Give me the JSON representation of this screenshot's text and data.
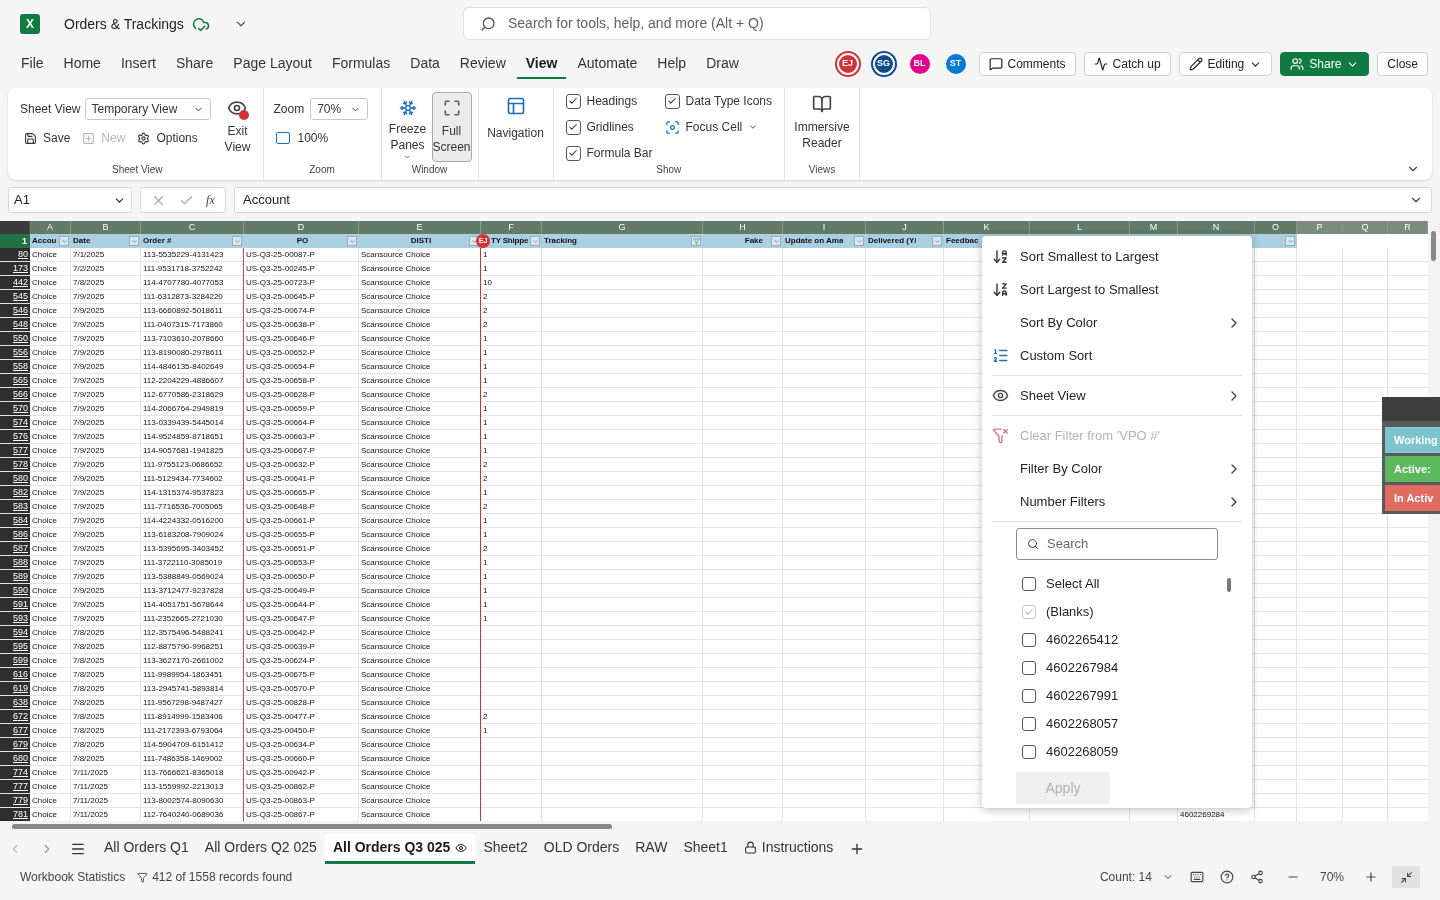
{
  "app": {
    "logo_text": "X",
    "title": "Orders & Trackings",
    "search_placeholder": "Search for tools, help, and more (Alt + Q)"
  },
  "menu_tabs": [
    {
      "label": "File",
      "selected": false
    },
    {
      "label": "Home",
      "selected": false
    },
    {
      "label": "Insert",
      "selected": false
    },
    {
      "label": "Share",
      "selected": false
    },
    {
      "label": "Page Layout",
      "selected": false
    },
    {
      "label": "Formulas",
      "selected": false
    },
    {
      "label": "Data",
      "selected": false
    },
    {
      "label": "Review",
      "selected": false
    },
    {
      "label": "View",
      "selected": true
    },
    {
      "label": "Automate",
      "selected": false
    },
    {
      "label": "Help",
      "selected": false
    },
    {
      "label": "Draw",
      "selected": false
    }
  ],
  "collaborators": [
    {
      "initials": "EJ",
      "color": "#d13438",
      "ring": true
    },
    {
      "initials": "SG",
      "color": "#0f4c8a",
      "ring": true
    },
    {
      "initials": "BL",
      "color": "#e3008c",
      "ring": false
    },
    {
      "initials": "ST",
      "color": "#0078d4",
      "ring": false
    }
  ],
  "header_buttons": [
    {
      "kind": "comments",
      "label": "Comments"
    },
    {
      "kind": "catch_up",
      "label": "Catch up"
    },
    {
      "kind": "editing",
      "label": "Editing"
    },
    {
      "kind": "share",
      "label": "Share"
    },
    {
      "kind": "close",
      "label": "Close"
    }
  ],
  "ribbon": {
    "sheet_view": {
      "label": "Sheet View",
      "view_label": "Sheet View",
      "view_value": "Temporary View",
      "exit": "Exit View",
      "actions": [
        {
          "kind": "save",
          "label": "Save",
          "disabled": false
        },
        {
          "kind": "new",
          "label": "New",
          "disabled": true
        },
        {
          "kind": "options",
          "label": "Options",
          "disabled": false
        }
      ]
    },
    "zoom": {
      "label": "Zoom",
      "zoom_label": "Zoom",
      "zoom_value": "70%",
      "reset": "100%"
    },
    "window": {
      "label": "Window",
      "buttons": [
        {
          "kind": "freeze",
          "label": "Freeze Panes",
          "dropdown": true,
          "selected": false
        },
        {
          "kind": "full_screen",
          "label": "Full Screen",
          "dropdown": false,
          "selected": true
        }
      ]
    },
    "navigation": {
      "label": "Navigation"
    },
    "show": {
      "label": "Show",
      "options": [
        {
          "kind": "checkbox",
          "label": "Headings",
          "checked": true
        },
        {
          "kind": "checkbox",
          "label": "Gridlines",
          "checked": true
        },
        {
          "kind": "checkbox",
          "label": "Formula Bar",
          "checked": true
        },
        {
          "kind": "checkbox",
          "label": "Data Type Icons",
          "checked": true
        },
        {
          "kind": "focus",
          "label": "Focus Cell"
        }
      ]
    },
    "views": {
      "label": "Views",
      "button": "Immersive Reader"
    }
  },
  "formula_bar": {
    "name_box": "A1",
    "function_label": "fx",
    "value": "Account"
  },
  "sheet": {
    "columns": [
      "A",
      "B",
      "C",
      "D",
      "E",
      "F",
      "G",
      "H",
      "I",
      "J",
      "K",
      "L",
      "M",
      "N",
      "O",
      "P",
      "Q",
      "R"
    ],
    "header_row": "1",
    "headers": [
      {
        "label": "Accou",
        "filtered": false
      },
      {
        "label": "Date",
        "filtered": false
      },
      {
        "label": "Order #",
        "filtered": false
      },
      {
        "label": "PO",
        "filtered": false
      },
      {
        "label": "DISTI",
        "filtered": false
      },
      {
        "label": "TY Shippe",
        "filtered": false
      },
      {
        "label": "Tracking",
        "filtered": true
      },
      {
        "label": "Fake",
        "filtered": false
      },
      {
        "label": "Update on Ama",
        "filtered": false
      },
      {
        "label": "Delivered (Y/",
        "filtered": false
      },
      {
        "label": "Feedbac"
      }
    ],
    "cursor": {
      "initials": "EJ",
      "color": "#d13438"
    },
    "rows": [
      {
        "number": "80",
        "cells": [
          "Choice",
          "7/1/2025",
          "113-5535229-4131423",
          "US-Q3-25-00087-P",
          "Scansource Choice"
        ],
        "qty": "1"
      },
      {
        "number": "173",
        "cells": [
          "Choice",
          "7/2/2025",
          "111-9531718-3752242",
          "US-Q3-25-00245-P",
          "Scansource Choice"
        ],
        "qty": "1"
      },
      {
        "number": "442",
        "cells": [
          "Choice",
          "7/8/2025",
          "114-4707780-4077053",
          "US-Q3-25-00723-P",
          "Scansource Choice"
        ],
        "qty": "10"
      },
      {
        "number": "545",
        "cells": [
          "Choice",
          "7/9/2025",
          "111-6312873-3284220",
          "US-Q3-25-00645-P",
          "Scansource Choice"
        ],
        "qty": "2"
      },
      {
        "number": "546",
        "cells": [
          "Choice",
          "7/9/2025",
          "113-6660892-5018611",
          "US-Q3-25-00674-P",
          "Scansource Choice"
        ],
        "qty": "2"
      },
      {
        "number": "548",
        "cells": [
          "Choice",
          "7/9/2025",
          "111-0407315-7173860",
          "US-Q3-25-00638-P",
          "Scansource Choice"
        ],
        "qty": "2"
      },
      {
        "number": "550",
        "cells": [
          "Choice",
          "7/9/2025",
          "113-7103610-2078660",
          "US-Q3-25-00646-P",
          "Scansource Choice"
        ],
        "qty": "1"
      },
      {
        "number": "556",
        "cells": [
          "Choice",
          "7/9/2025",
          "113-8190080-2978611",
          "US-Q3-25-00652-P",
          "Scansource Choice"
        ],
        "qty": "1"
      },
      {
        "number": "558",
        "cells": [
          "Choice",
          "7/9/2025",
          "114-4846135-8402649",
          "US-Q3-25-00654-P",
          "Scansource Choice"
        ],
        "qty": "1"
      },
      {
        "number": "565",
        "cells": [
          "Choice",
          "7/9/2025",
          "112-2204229-4886607",
          "US-Q3-25-00658-P",
          "Scansource Choice"
        ],
        "qty": "1"
      },
      {
        "number": "566",
        "cells": [
          "Choice",
          "7/9/2025",
          "112-6770586-2318629",
          "US-Q3-25-00628-P",
          "Scansource Choice"
        ],
        "qty": "2"
      },
      {
        "number": "570",
        "cells": [
          "Choice",
          "7/9/2025",
          "114-2066764-2949819",
          "US-Q3-25-00659-P",
          "Scansource Choice"
        ],
        "qty": "1"
      },
      {
        "number": "574",
        "cells": [
          "Choice",
          "7/9/2025",
          "113-0339439-5445014",
          "US-Q3-25-00664-P",
          "Scansource Choice"
        ],
        "qty": "1"
      },
      {
        "number": "576",
        "cells": [
          "Choice",
          "7/9/2025",
          "114-9524859-8718651",
          "US-Q3-25-00663-P",
          "Scansource Choice"
        ],
        "qty": "1"
      },
      {
        "number": "577",
        "cells": [
          "Choice",
          "7/9/2025",
          "114-9057681-1941825",
          "US-Q3-25-00667-P",
          "Scansource Choice"
        ],
        "qty": "1"
      },
      {
        "number": "578",
        "cells": [
          "Choice",
          "7/9/2025",
          "111-9755123-0686652",
          "US-Q3-25-00632-P",
          "Scansource Choice"
        ],
        "qty": "2"
      },
      {
        "number": "580",
        "cells": [
          "Choice",
          "7/9/2025",
          "111-5129434-7734602",
          "US-Q3-25-00641-P",
          "Scansource Choice"
        ],
        "qty": "2"
      },
      {
        "number": "582",
        "cells": [
          "Choice",
          "7/9/2025",
          "114-1315374-9537823",
          "US-Q3-25-00665-P",
          "Scansource Choice"
        ],
        "qty": "1"
      },
      {
        "number": "583",
        "cells": [
          "Choice",
          "7/9/2025",
          "111-7716536-7005065",
          "US-Q3-25-00648-P",
          "Scansource Choice"
        ],
        "qty": "2"
      },
      {
        "number": "584",
        "cells": [
          "Choice",
          "7/9/2025",
          "114-4224332-0516200",
          "US-Q3-25-00661-P",
          "Scansource Choice"
        ],
        "qty": "1"
      },
      {
        "number": "586",
        "cells": [
          "Choice",
          "7/9/2025",
          "113-6183208-7909024",
          "US-Q3-25-00655-P",
          "Scansource Choice"
        ],
        "qty": "1"
      },
      {
        "number": "587",
        "cells": [
          "Choice",
          "7/9/2025",
          "113-5395695-3403452",
          "US-Q3-25-00651-P",
          "Scansource Choice"
        ],
        "qty": "2"
      },
      {
        "number": "588",
        "cells": [
          "Choice",
          "7/9/2025",
          "111-3722110-3085019",
          "US-Q3-25-00653-P",
          "Scansource Choice"
        ],
        "qty": "1"
      },
      {
        "number": "589",
        "cells": [
          "Choice",
          "7/9/2025",
          "113-5388849-0569024",
          "US-Q3-25-00650-P",
          "Scansource Choice"
        ],
        "qty": "1"
      },
      {
        "number": "590",
        "cells": [
          "Choice",
          "7/9/2025",
          "113-3712477-9237828",
          "US-Q3-25-00649-P",
          "Scansource Choice"
        ],
        "qty": "1"
      },
      {
        "number": "591",
        "cells": [
          "Choice",
          "7/9/2025",
          "114-4051751-5678644",
          "US-Q3-25-00644-P",
          "Scansource Choice"
        ],
        "qty": "1"
      },
      {
        "number": "593",
        "cells": [
          "Choice",
          "7/9/2025",
          "111-2352665-2721030",
          "US-Q3-25-00647-P",
          "Scansource Choice"
        ],
        "qty": "1"
      },
      {
        "number": "594",
        "cells": [
          "Choice",
          "7/8/2025",
          "112-3575496-5488241",
          "US-Q3-25-00642-P",
          "Scansource Choice"
        ]
      },
      {
        "number": "595",
        "cells": [
          "Choice",
          "7/8/2025",
          "112-8875790-9968251",
          "US-Q3-25-00639-P",
          "Scansource Choice"
        ]
      },
      {
        "number": "599",
        "cells": [
          "Choice",
          "7/8/2025",
          "113-3627170-2661002",
          "US-Q3-25-00624-P",
          "Scansource Choice"
        ]
      },
      {
        "number": "616",
        "cells": [
          "Choice",
          "7/8/2025",
          "111-9989954-1863451",
          "US-Q3-25-00675-P",
          "Scansource Choice"
        ]
      },
      {
        "number": "619",
        "cells": [
          "Choice",
          "7/8/2025",
          "113-2945741-5893814",
          "US-Q3-25-00570-P",
          "Scansource Choice"
        ]
      },
      {
        "number": "638",
        "cells": [
          "Choice",
          "7/8/2025",
          "111-9567298-9487427",
          "US-Q3-25-00828-P",
          "Scansource Choice"
        ]
      },
      {
        "number": "672",
        "cells": [
          "Choice",
          "7/8/2025",
          "111-8914999-1583406",
          "US-Q3-25-00477-P",
          "Scansource Choice"
        ],
        "qty": "2"
      },
      {
        "number": "677",
        "cells": [
          "Choice",
          "7/8/2025",
          "111-2172393-6793064",
          "US-Q3-25-00450-P",
          "Scansource Choice"
        ],
        "qty": "1"
      },
      {
        "number": "679",
        "cells": [
          "Choice",
          "7/8/2025",
          "114-5904709-6151412",
          "US-Q3-25-00634-P",
          "Scansource Choice"
        ]
      },
      {
        "number": "680",
        "cells": [
          "Choice",
          "7/8/2025",
          "111-7486358-1469002",
          "US-Q3-25-00660-P",
          "Scansource Choice"
        ]
      },
      {
        "number": "774",
        "cells": [
          "Choice",
          "7/11/2025",
          "113-7666621-8365018",
          "US-Q3-25-00942-P",
          "Scansource Choice"
        ]
      },
      {
        "number": "777",
        "cells": [
          "Choice",
          "7/11/2025",
          "113-1559992-2213013",
          "US-Q3-25-00862-P",
          "Scansource Choice"
        ]
      },
      {
        "number": "779",
        "cells": [
          "Choice",
          "7/11/2025",
          "113-8002574-8090630",
          "US-Q3-25-00863-P",
          "Scansource Choice"
        ]
      },
      {
        "number": "781",
        "cells": [
          "Choice",
          "7/11/2025",
          "112-7640240-0689036",
          "US-Q3-25-00867-P",
          "Scansource Choice"
        ],
        "column_n": "4602269284"
      }
    ]
  },
  "filter_menu": {
    "items": [
      {
        "kind": "sort_asc",
        "label": "Sort Smallest to Largest",
        "submenu": false,
        "disabled": false
      },
      {
        "kind": "sort_desc",
        "label": "Sort Largest to Smallest",
        "submenu": false,
        "disabled": false
      },
      {
        "kind": "plain",
        "label": "Sort By Color",
        "submenu": true,
        "disabled": false
      },
      {
        "kind": "custom_sort",
        "label": "Custom Sort",
        "submenu": false,
        "disabled": false
      },
      {
        "kind": "divider"
      },
      {
        "kind": "sheet_view",
        "label": "Sheet View",
        "submenu": true,
        "disabled": false
      },
      {
        "kind": "divider"
      },
      {
        "kind": "clear_filter",
        "label": "Clear Filter from 'VPO #'",
        "submenu": false,
        "disabled": true
      },
      {
        "kind": "plain",
        "label": "Filter By Color",
        "submenu": true,
        "disabled": false
      },
      {
        "kind": "plain",
        "label": "Number Filters",
        "submenu": true,
        "disabled": false
      },
      {
        "kind": "divider"
      }
    ],
    "search_placeholder": "Search",
    "values": [
      {
        "label": "Select All",
        "checked": false,
        "disabled": false
      },
      {
        "label": "(Blanks)",
        "checked": true,
        "disabled": true
      },
      {
        "label": "4602265412",
        "checked": false,
        "disabled": false
      },
      {
        "label": "4602267984",
        "checked": false,
        "disabled": false
      },
      {
        "label": "4602267991",
        "checked": false,
        "disabled": false
      },
      {
        "label": "4602268057",
        "checked": false,
        "disabled": false
      },
      {
        "label": "4602268059",
        "checked": false,
        "disabled": false
      }
    ],
    "apply": {
      "label": "Apply",
      "disabled": true
    }
  },
  "legend": [
    {
      "label": "Working",
      "color": "#7cc4cf"
    },
    {
      "label": "Active:",
      "color": "#5cb85c"
    },
    {
      "label": "In Activ",
      "color": "#e06b5f"
    }
  ],
  "sheet_tabs": [
    {
      "label": "All Orders Q1",
      "selected": false,
      "kind": "plain"
    },
    {
      "label": "All Orders Q2 025",
      "selected": false,
      "kind": "plain"
    },
    {
      "label": "All Orders Q3 025",
      "selected": true,
      "kind": "view"
    },
    {
      "label": "Sheet2",
      "selected": false,
      "kind": "plain"
    },
    {
      "label": "OLD Orders",
      "selected": false,
      "kind": "plain"
    },
    {
      "label": "RAW",
      "selected": false,
      "kind": "plain"
    },
    {
      "label": "Sheet1",
      "selected": false,
      "kind": "plain"
    },
    {
      "label": "Instructions",
      "selected": false,
      "kind": "locked"
    }
  ],
  "status_bar": {
    "workbook_statistics": "Workbook Statistics",
    "records": "412 of 1558 records found",
    "count": "Count: 14",
    "zoom": "70%"
  }
}
